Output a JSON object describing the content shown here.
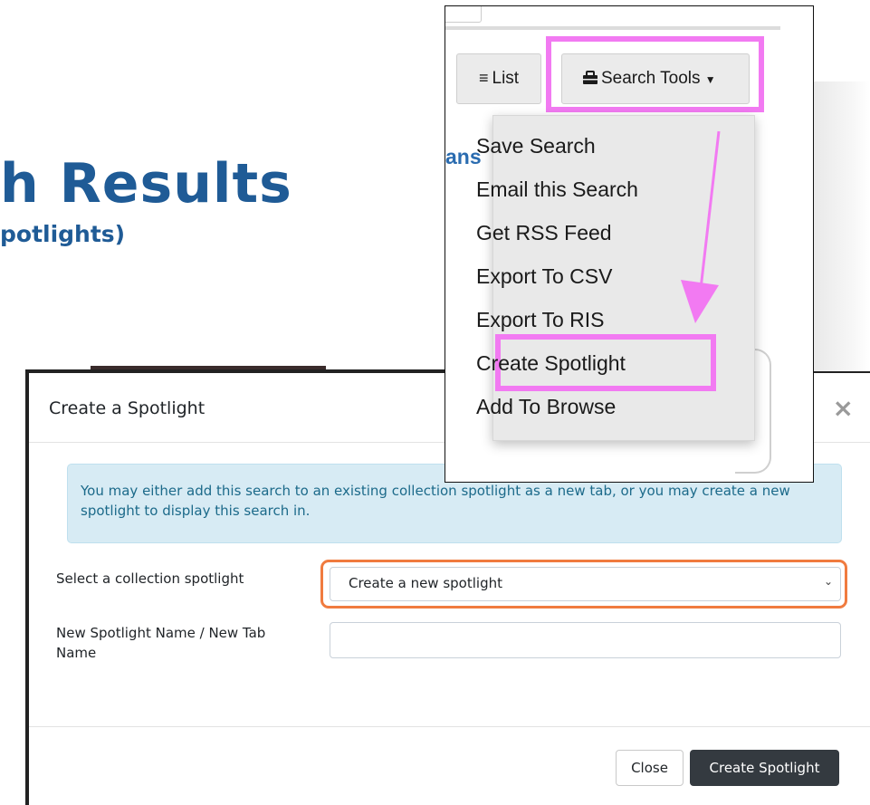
{
  "slide": {
    "title": "h Results",
    "subtitle": "potlights)"
  },
  "toolbar": {
    "list_label": "List",
    "search_tools_label": "Search Tools",
    "partial_link_text": "ans"
  },
  "search_tools_menu": {
    "items": [
      "Save Search",
      "Email this Search",
      "Get RSS Feed",
      "Export To CSV",
      "Export To RIS",
      "Create Spotlight",
      "Add To Browse"
    ],
    "highlighted_item": "Create Spotlight"
  },
  "modal": {
    "title": "Create a Spotlight",
    "close_glyph": "×",
    "info_text_line1": "You may either add this search to an existing collection spotlight as a new tab, or you may create a new",
    "info_text_line2": "spotlight to display this search in.",
    "select_label": "Select a collection spotlight",
    "select_value": "Create a new spotlight",
    "name_label_line1": "New Spotlight Name / New Tab",
    "name_label_line2": "Name",
    "name_input_value": "",
    "close_button": "Close",
    "create_button": "Create Spotlight"
  },
  "colors": {
    "highlight_pink": "#f27af2",
    "highlight_orange": "#f07b3f",
    "title_blue": "#1f5b96",
    "primary_dark": "#343a40",
    "info_bg": "#d7ebf4"
  },
  "icons": {
    "list": "list-icon",
    "search_tools": "toolbox-icon",
    "caret": "caret-down-icon",
    "close": "close-icon",
    "select": "chevron-down-icon",
    "annotation": "arrow-annotation"
  }
}
